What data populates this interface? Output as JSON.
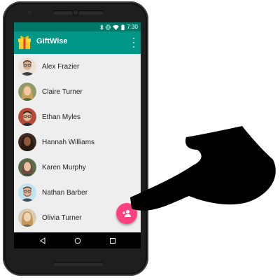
{
  "status_bar": {
    "time": "7:30",
    "icons": [
      "bluetooth-icon",
      "vibrate-icon",
      "wifi-icon",
      "battery-icon"
    ]
  },
  "app_bar": {
    "title": "GiftWise",
    "logo_icon": "gift-box-icon",
    "overflow_icon": "more-vert-icon"
  },
  "contacts": [
    {
      "name": "Alex Frazier"
    },
    {
      "name": "Claire Turner"
    },
    {
      "name": "Ethan Myles"
    },
    {
      "name": "Hannah Williams"
    },
    {
      "name": "Karen Murphy"
    },
    {
      "name": "Nathan Barber"
    },
    {
      "name": "Olivia Turner"
    }
  ],
  "fab": {
    "icon": "add-person-icon"
  },
  "nav_bar": {
    "icons": [
      "back-icon",
      "home-icon",
      "recents-icon"
    ]
  },
  "colors": {
    "status_bar": "#00796b",
    "app_bar": "#009688",
    "list_background": "#eeeeee",
    "fab": "#ff4081",
    "phone_body": "#1e1e1e"
  }
}
